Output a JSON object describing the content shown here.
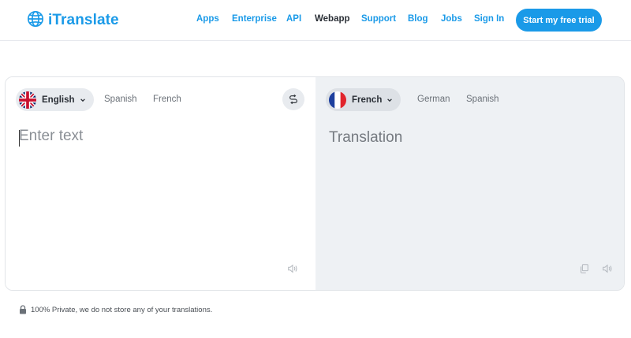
{
  "header": {
    "logo_text": "iTranslate",
    "nav": [
      {
        "label": "Apps",
        "color": "#1a9ae8"
      },
      {
        "label": "Enterprise",
        "color": "#1a9ae8"
      },
      {
        "label": "API",
        "color": "#1a9ae8"
      },
      {
        "label": "Webapp",
        "color": "#2a2f36"
      },
      {
        "label": "Support",
        "color": "#1a9ae8"
      },
      {
        "label": "Blog",
        "color": "#1a9ae8"
      },
      {
        "label": "Jobs",
        "color": "#1a9ae8"
      },
      {
        "label": "Sign In",
        "color": "#1a9ae8"
      }
    ],
    "cta_label": "Start my free trial"
  },
  "source": {
    "selected": "English",
    "flag": "uk-flag-icon",
    "alternatives": [
      "Spanish",
      "French"
    ],
    "placeholder": "Enter text",
    "value": ""
  },
  "target": {
    "selected": "French",
    "flag": "france-flag-icon",
    "alternatives": [
      "German",
      "Spanish"
    ],
    "placeholder": "Translation"
  },
  "icons": {
    "swap": "swap-icon",
    "speaker": "speaker-icon",
    "copy": "copy-icon",
    "lock": "lock-icon",
    "chevron": "chevron-down-icon",
    "globe": "globe-icon"
  },
  "privacy_text": "100% Private, we do not store any of your translations.",
  "colors": {
    "brand": "#1a9ae8",
    "target_pane_bg": "#eef1f4",
    "pill_bg": "#e8ebef"
  }
}
